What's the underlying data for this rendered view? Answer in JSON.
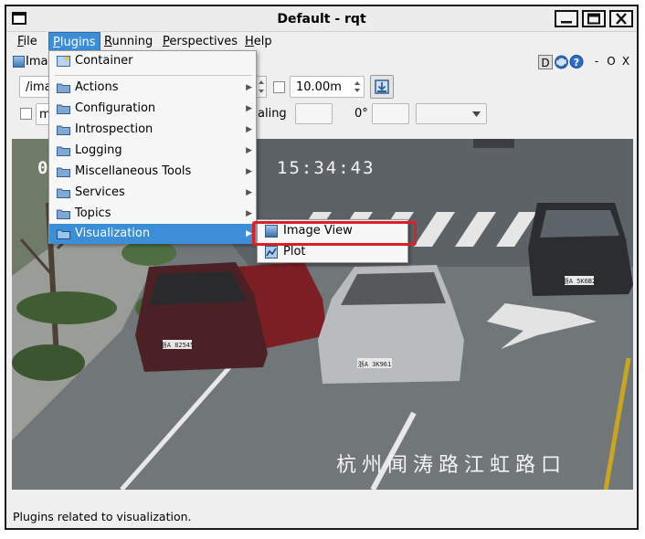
{
  "window": {
    "title": "Default - rqt"
  },
  "menubar": {
    "items": [
      {
        "label": "File",
        "mnemonic": "F",
        "rest": "ile"
      },
      {
        "label": "Plugins",
        "mnemonic": "P",
        "rest": "lugins"
      },
      {
        "label": "Running",
        "mnemonic": "R",
        "rest": "unning"
      },
      {
        "label": "Perspectives",
        "mnemonic": "P",
        "rest": "erspectives"
      },
      {
        "label": "Help",
        "mnemonic": "H",
        "rest": "elp"
      }
    ]
  },
  "plugin": {
    "tab_label": "Image View",
    "tab_label_visible": "Imag",
    "topic_value_visible": "/ima",
    "checkbox_label_visible": "m",
    "interval_value": "10.00m",
    "scaling_label_visible": "aling",
    "rotation_value": "0°",
    "dock_buttons": [
      "D",
      "O",
      "X"
    ]
  },
  "camera_overlay": {
    "time": "15:34:43",
    "location": "杭州闻涛路江虹路口",
    "plate_left": "浙A 82545",
    "plate_center": "浙A 3K961",
    "plate_right": "浙A 5K6B2"
  },
  "plugins_menu": {
    "items": [
      {
        "label": "Container",
        "has_submenu": false
      },
      {
        "label": "Actions",
        "has_submenu": true
      },
      {
        "label": "Configuration",
        "has_submenu": true
      },
      {
        "label": "Introspection",
        "has_submenu": true
      },
      {
        "label": "Logging",
        "has_submenu": true
      },
      {
        "label": "Miscellaneous Tools",
        "has_submenu": true
      },
      {
        "label": "Services",
        "has_submenu": true
      },
      {
        "label": "Topics",
        "has_submenu": true
      },
      {
        "label": "Visualization",
        "has_submenu": true,
        "highlighted": true
      }
    ]
  },
  "visualization_submenu": {
    "items": [
      {
        "label": "Image View",
        "icon": "image-view-icon"
      },
      {
        "label": "Plot",
        "icon": "plot-icon"
      }
    ]
  },
  "statusbar": {
    "text": "Plugins related to visualization."
  },
  "colors": {
    "menu_highlight": "#3d8ed8",
    "annotation_red": "#d9202a"
  }
}
